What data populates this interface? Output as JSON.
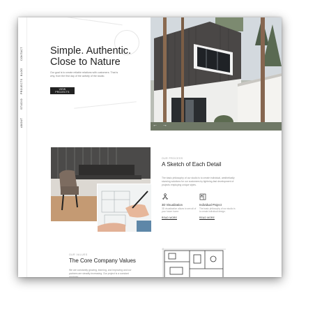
{
  "nav": {
    "items": [
      "ABOUT",
      "STUDIO",
      "PROJECTS",
      "BLOG",
      "CONTACT"
    ]
  },
  "hero": {
    "title_line1": "Simple. Authentic.",
    "title_line2": "Close to Nature",
    "text": "Our goal is to create reliable relations with customers. That is why, from the first day of the activity of the studio.",
    "button_label": "VIEW PROJECTS",
    "arrow_prev": "←",
    "arrow_next": "→"
  },
  "sketch": {
    "eyebrow": "OUR PROCESS",
    "title": "A Sketch of Each Detail",
    "text": "The basic philosophy of our studio is to create individual, aesthetically stunning solutions for our customers by lightning-fast development of projects employing unique styles.",
    "features": [
      {
        "icon": "compass-icon",
        "title": "3D Visualization",
        "text": "3D visualization allows to see all of your future home.",
        "link": "READ MORE"
      },
      {
        "icon": "blueprint-icon",
        "title": "Individual Project",
        "text": "The basic philosophy of our studio is to create individual design.",
        "link": "READ MORE"
      }
    ]
  },
  "values": {
    "eyebrow": "OUR VALUES",
    "title": "The Core Company Values",
    "text": "We are constantly growing, learning, and improving and our partners are steadily increasing. Our project is a constant reminder"
  },
  "colors": {
    "dark": "#222222",
    "muted": "#888888",
    "page_bg": "#ffffff"
  }
}
